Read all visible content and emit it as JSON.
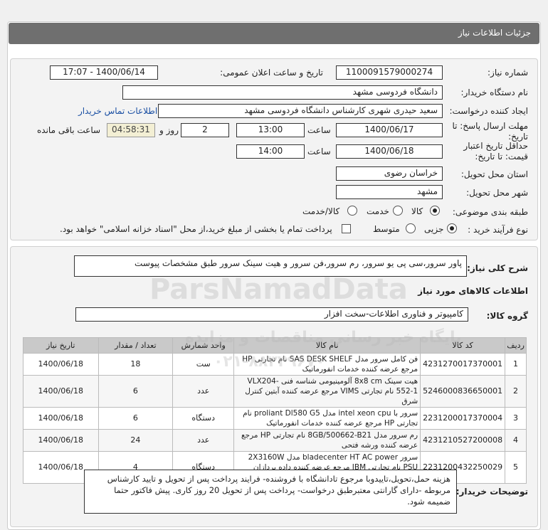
{
  "header": {
    "title": "جزئیات اطلاعات نیاز"
  },
  "form": {
    "need_number_label": "شماره نیاز:",
    "need_number": "1100091579000274",
    "announce_label": "تاریخ و ساعت اعلان عمومی:",
    "announce_value": "1400/06/14 - 17:07",
    "buyer_org_label": "نام دستگاه خریدار:",
    "buyer_org": "دانشگاه فردوسی مشهد",
    "requester_label": "ایجاد کننده درخواست:",
    "requester": "سعید حیدری شهری کارشناس دانشگاه فردوسی مشهد",
    "contact_link": "اطلاعات تماس خریدار",
    "deadline_label": "مهلت ارسال پاسخ: تا تاریخ:",
    "deadline_date": "1400/06/17",
    "time_label": "ساعت",
    "deadline_time": "13:00",
    "days_value": "2",
    "days_label": "روز و",
    "remaining_time": "04:58:31",
    "remaining_label": "ساعت باقی مانده",
    "validity_label": "حداقل تاریخ اعتبار قیمت: تا تاریخ:",
    "validity_date": "1400/06/18",
    "validity_time": "14:00",
    "province_label": "استان محل تحویل:",
    "province": "خراسان رضوی",
    "city_label": "شهر محل تحویل:",
    "city": "مشهد",
    "category_label": "طبقه بندی موضوعی:",
    "category_options": [
      "کالا",
      "خدمت",
      "کالا/خدمت"
    ],
    "process_label": "نوع فرآیند خرید :",
    "process_options": [
      "جزیی",
      "متوسط"
    ],
    "payment_note": "پرداخت تمام یا بخشی از مبلغ خرید،از محل \"اسناد خزانه اسلامی\" خواهد بود."
  },
  "summary": {
    "label": "شرح کلی نیاز:",
    "value": "پاور سرور،سی پی یو سرور، رم سرور،فن سرور و هیت سینک سرور طبق مشخصات پیوست"
  },
  "goods": {
    "section_title": "اطلاعات کالاهای مورد نیاز",
    "group_label": "گروه کالا:",
    "group_value": "کامپیوتر و فناوری اطلاعات-سخت افزار",
    "columns": [
      "ردیف",
      "کد کالا",
      "نام کالا",
      "واحد شمارش",
      "تعداد / مقدار",
      "تاریخ نیاز"
    ],
    "rows": [
      [
        "1",
        "4231270017370001",
        "فن کامل سرور مدل SAS DESK SHELF نام تجارتی HP مرجع عرضه کننده خدمات انفورماتیک",
        "ست",
        "18",
        "1400/06/18"
      ],
      [
        "2",
        "5246000836650001",
        "هیت سینک 8x8 cm آلومینیومی شناسه فنی VLX204-552-1 نام تجارتی VIMS مرجع عرضه کننده آبتین کنترل شرق",
        "عدد",
        "6",
        "1400/06/18"
      ],
      [
        "3",
        "2231200017370004",
        "سرور با intel xeon cpu مدل proliant Dl580 G5 نام تجارتی HP مرجع عرضه کننده خدمات انفورماتیک",
        "دستگاه",
        "6",
        "1400/06/18"
      ],
      [
        "4",
        "4231210527200008",
        "رم سرور مدل 8GB/500662-B21 نام تجارتی HP مرجع عرضه کننده ورشه فتحی",
        "عدد",
        "24",
        "1400/06/18"
      ],
      [
        "5",
        "2231200432250029",
        "سرور bladecenter HT AC power مدل 2X3160W PSU نام تجارتی IBM مرجع عرضه کننده داده پردازان دوران",
        "دستگاه",
        "4",
        "1400/06/18"
      ]
    ]
  },
  "buyer_notes": {
    "label": "توضیحات خریدار:",
    "value": "هزینه حمل،تحویل،تاییدوبا مرجوع تادانشگاه با فروشنده- فرایند پرداخت پس از تحویل و تایید کارشناس مربوطه -دارای گارانتی معتبرطبق درخواست- پرداخت پس از تحویل 20 روز کاری. پیش فاکتور حتما ضمیمه شود."
  },
  "watermark": {
    "brand": "ParsNamadData",
    "tagline": "پایگاه خبر رسانی مناقصات و مزایده",
    "phone": "۰۲۱-۸۸۳۴۹۶۷۰"
  }
}
